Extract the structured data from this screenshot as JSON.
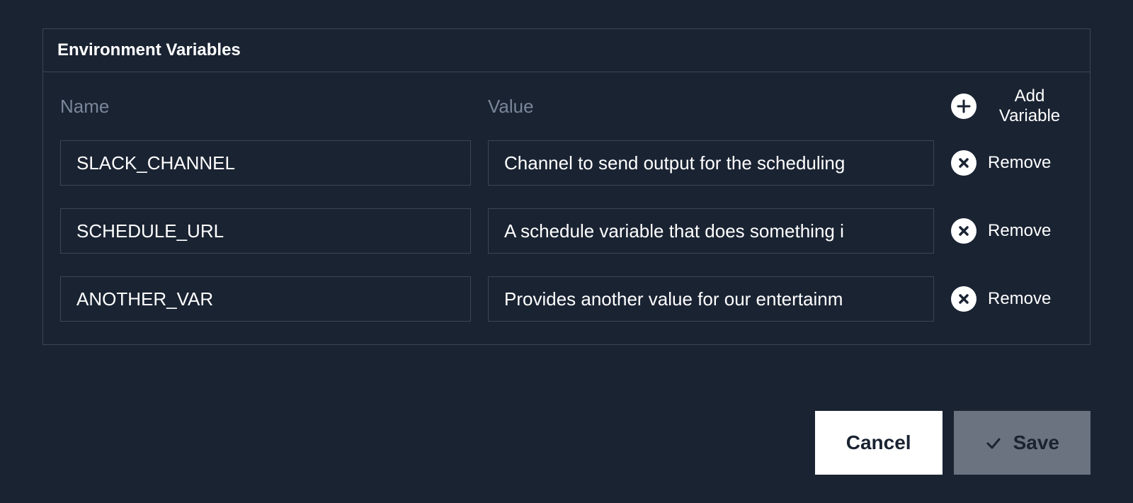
{
  "panel": {
    "title": "Environment Variables",
    "headers": {
      "name": "Name",
      "value": "Value"
    },
    "addButton": "Add Variable",
    "removeButton": "Remove"
  },
  "variables": [
    {
      "name": "SLACK_CHANNEL",
      "value": "Channel to send output for the scheduling"
    },
    {
      "name": "SCHEDULE_URL",
      "value": "A schedule variable that does something i"
    },
    {
      "name": "ANOTHER_VAR",
      "value": "Provides another value for our entertainm"
    }
  ],
  "footer": {
    "cancel": "Cancel",
    "save": "Save"
  }
}
